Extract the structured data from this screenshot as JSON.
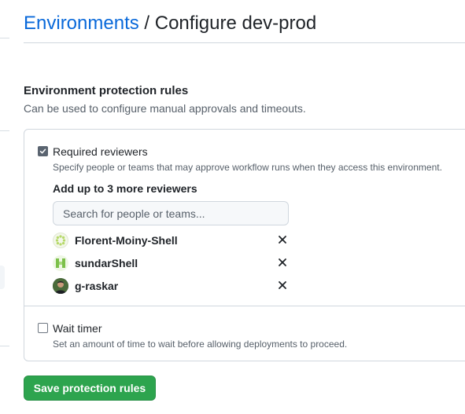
{
  "header": {
    "breadcrumb_link": "Environments",
    "separator": "/",
    "page_title": "Configure dev-prod"
  },
  "protection": {
    "title": "Environment protection rules",
    "description": "Can be used to configure manual approvals and timeouts."
  },
  "required_reviewers": {
    "checked": true,
    "label": "Required reviewers",
    "description": "Specify people or teams that may approve workflow runs when they access this environment.",
    "add_label": "Add up to 3 more reviewers",
    "search_placeholder": "Search for people or teams...",
    "reviewers": [
      {
        "name": "Florent-Moiny-Shell",
        "avatar_icon": "identicon-green-dots",
        "remove_icon": "close-icon"
      },
      {
        "name": "sundarShell",
        "avatar_icon": "identicon-green-grid",
        "remove_icon": "close-icon"
      },
      {
        "name": "g-raskar",
        "avatar_icon": "user-photo",
        "remove_icon": "close-icon"
      }
    ]
  },
  "wait_timer": {
    "checked": false,
    "label": "Wait timer",
    "description": "Set an amount of time to wait before allowing deployments to proceed."
  },
  "actions": {
    "save_label": "Save protection rules"
  },
  "colors": {
    "link": "#0969da",
    "primary_button": "#2da44e",
    "border": "#d0d7de",
    "muted_text": "#57606a"
  }
}
